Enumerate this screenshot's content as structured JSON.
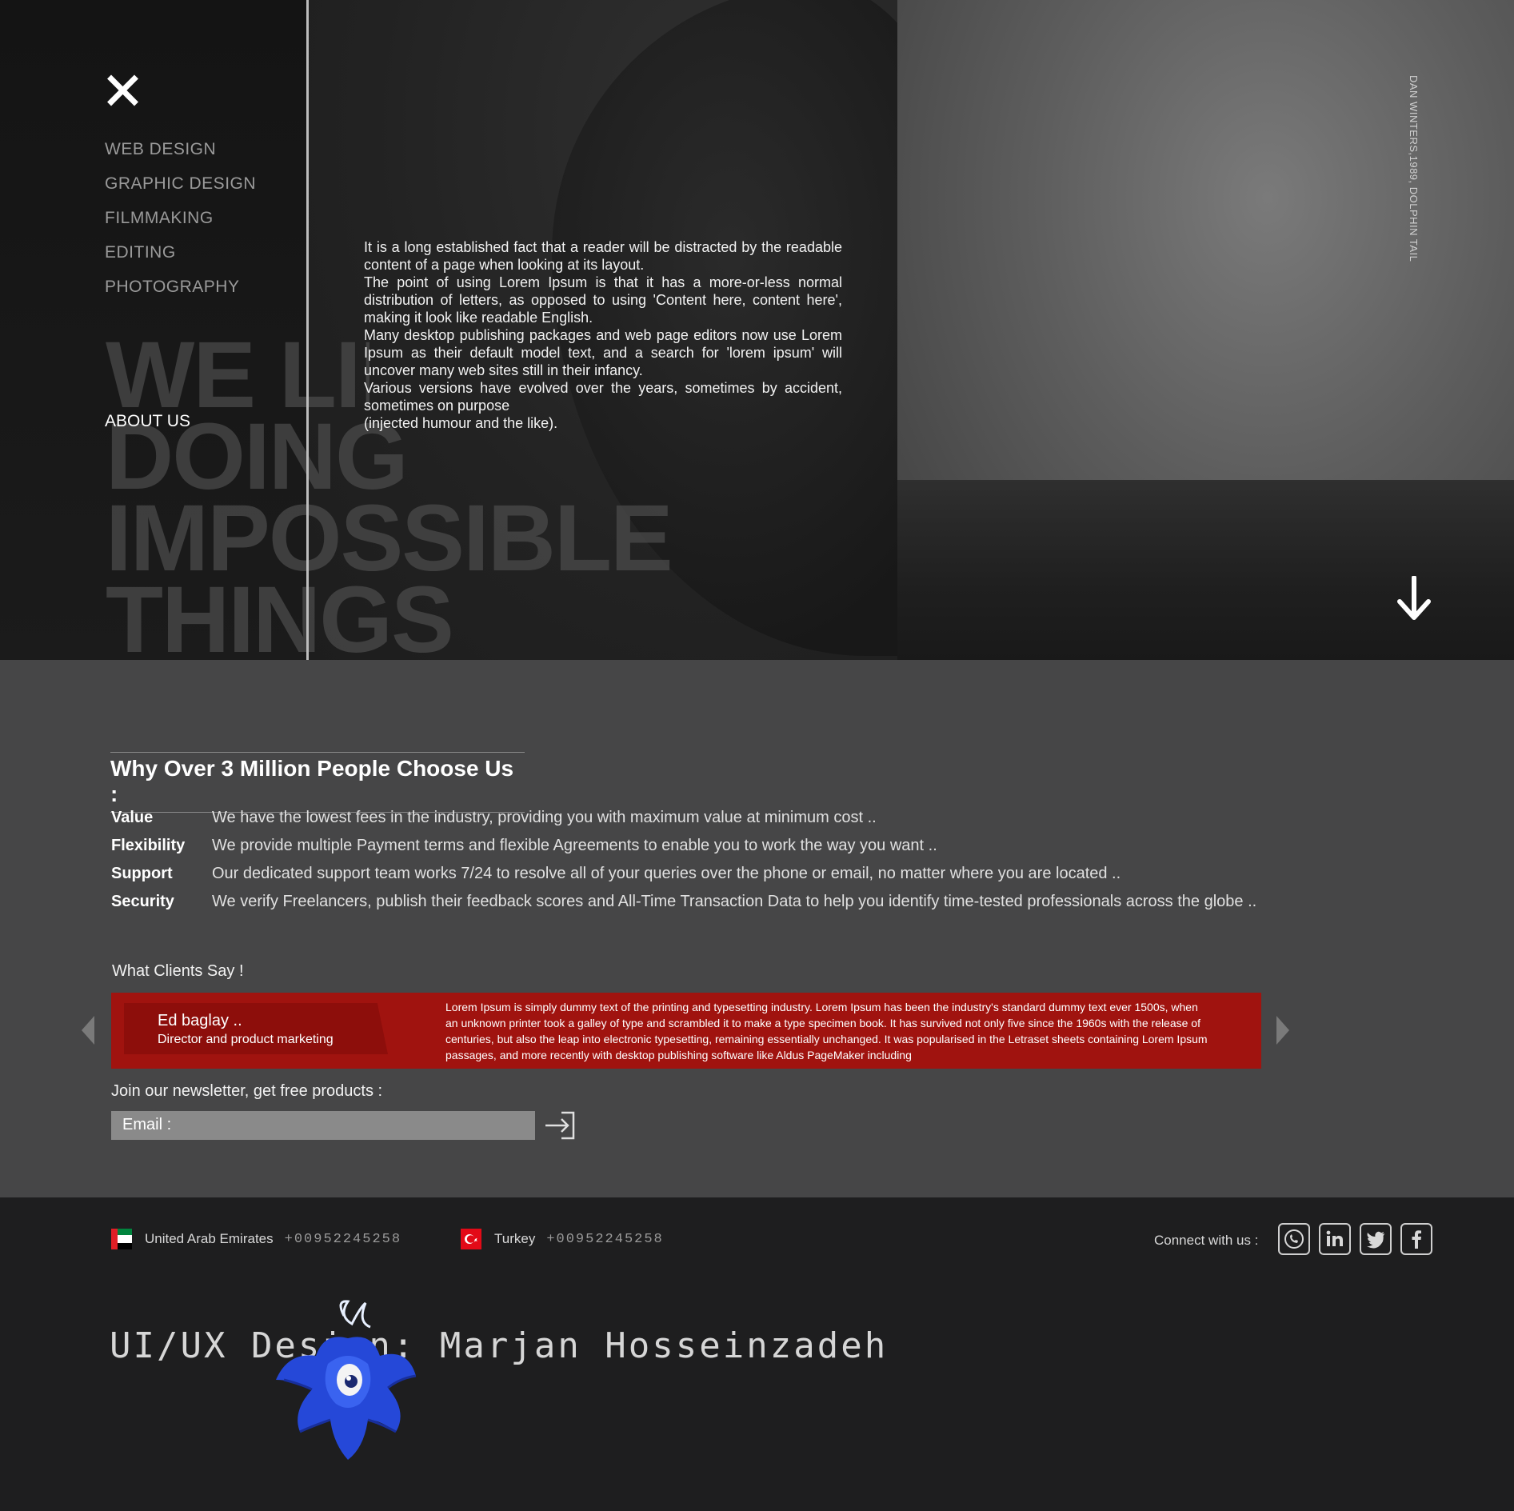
{
  "hero": {
    "menu": [
      "WEB DESIGN",
      "GRAPHIC DESIGN",
      "FILMMAKING",
      "EDITING",
      "PHOTOGRAPHY"
    ],
    "about_us": "ABOUT US",
    "slogan": [
      "WE LIKE",
      "DOING",
      "IMPOSSIBLE",
      "THINGS"
    ],
    "paragraphs": [
      "It is a long established fact that a reader will be distracted by the readable content of a page when looking at its layout.",
      "The point of using Lorem Ipsum is that it has a more-or-less normal distribution of letters, as opposed to using 'Content here, content here', making it look like readable English.",
      "Many desktop publishing packages and web page editors now use Lorem Ipsum as their default model text, and a search for 'lorem ipsum' will uncover many web sites still in their infancy.",
      "Various versions have evolved over the years, sometimes by accident, sometimes on purpose",
      "(injected humour and the like)."
    ],
    "photo_credit": "DAN WINTERS,1989, DOLPHIN TAIL",
    "icons": {
      "close": "close-icon",
      "scroll": "arrow-down-icon"
    }
  },
  "why": {
    "title": "Why Over 3 Million People Choose Us :",
    "features": [
      {
        "key": "Value",
        "text": "We have the lowest fees in the industry, providing you with maximum value at minimum cost .."
      },
      {
        "key": "Flexibility",
        "text": "We provide multiple Payment terms and flexible Agreements to enable you to work the way you want .."
      },
      {
        "key": "Support",
        "text": "Our dedicated support team works 7/24 to resolve all of your queries over the phone or email, no matter where you are located .."
      },
      {
        "key": "Security",
        "text": "We verify Freelancers, publish their feedback scores and All-Time Transaction Data to help you identify time-tested professionals across the globe .."
      }
    ]
  },
  "clients": {
    "title": "What Clients Say !",
    "name": "Ed baglay ..",
    "role": "Director and product marketing",
    "quote": "Lorem Ipsum is simply dummy text of the printing and typesetting industry. Lorem Ipsum has been the industry's standard dummy text ever 1500s, when an unknown printer took a galley of type and scrambled it to make a type specimen book. It has survived not only five since the 1960s with the release of centuries, but also the leap into electronic typesetting, remaining essentially unchanged. It was popularised in the Letraset sheets containing Lorem Ipsum passages, and more recently with desktop publishing software like Aldus PageMaker including",
    "accent_color": "#a0130f"
  },
  "newsletter": {
    "title": "Join our newsletter, get free products :",
    "email_label": "Email :"
  },
  "footer": {
    "contacts": [
      {
        "country": "United Arab Emirates",
        "phone": "+00952245258"
      },
      {
        "country": "Turkey",
        "phone": "+00952245258"
      }
    ],
    "connect_label": "Connect with us :",
    "socials": [
      "whatsapp-icon",
      "linkedin-icon",
      "twitter-icon",
      "facebook-icon"
    ],
    "designer": "UI/UX Design: Marjan Hosseinzadeh"
  }
}
